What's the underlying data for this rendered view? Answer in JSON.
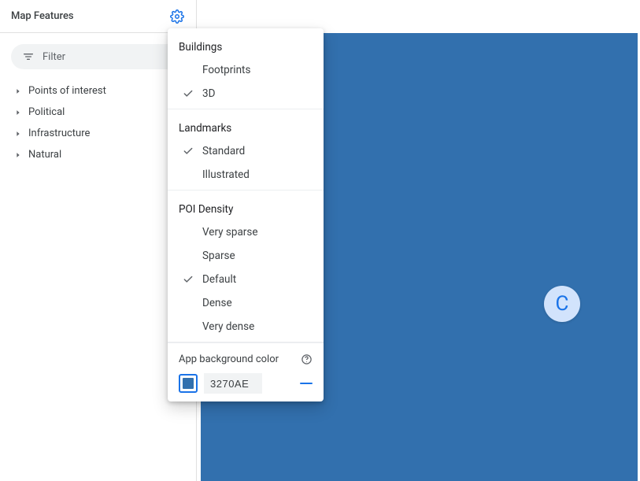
{
  "sidebar": {
    "title": "Map Features",
    "filter_label": "Filter",
    "items": [
      {
        "label": "Points of interest"
      },
      {
        "label": "Political"
      },
      {
        "label": "Infrastructure"
      },
      {
        "label": "Natural"
      }
    ]
  },
  "dropdown": {
    "sections": [
      {
        "heading": "Buildings",
        "options": [
          {
            "label": "Footprints",
            "selected": false
          },
          {
            "label": "3D",
            "selected": true
          }
        ]
      },
      {
        "heading": "Landmarks",
        "options": [
          {
            "label": "Standard",
            "selected": true
          },
          {
            "label": "Illustrated",
            "selected": false
          }
        ]
      },
      {
        "heading": "POI Density",
        "options": [
          {
            "label": "Very sparse",
            "selected": false
          },
          {
            "label": "Sparse",
            "selected": false
          },
          {
            "label": "Default",
            "selected": true
          },
          {
            "label": "Dense",
            "selected": false
          },
          {
            "label": "Very dense",
            "selected": false
          }
        ]
      }
    ],
    "bg_color": {
      "label": "App background color",
      "hex": "3270AE"
    }
  },
  "map": {
    "background_color": "#3270AE",
    "badge_letter": "C"
  }
}
